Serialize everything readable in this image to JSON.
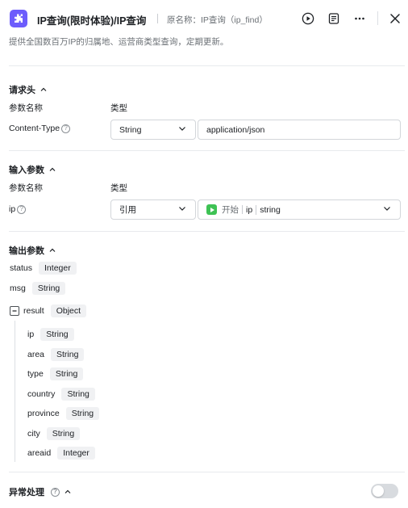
{
  "header": {
    "title": "IP查询(限时体验)/IP查询",
    "original_name": "原名称：IP查询（ip_find）",
    "description": "提供全国数百万IP的归属地、运营商类型查询，定期更新。"
  },
  "request_headers": {
    "title": "请求头",
    "col_name": "参数名称",
    "col_type": "类型",
    "rows": [
      {
        "name": "Content-Type",
        "type": "String",
        "value": "application/json"
      }
    ]
  },
  "input_params": {
    "title": "输入参数",
    "col_name": "参数名称",
    "col_type": "类型",
    "rows": [
      {
        "name": "ip",
        "type": "引用",
        "ref_node": "开始",
        "ref_field": "ip",
        "ref_type": "string"
      }
    ]
  },
  "output_params": {
    "title": "输出参数",
    "items": [
      {
        "name": "status",
        "type": "Integer"
      },
      {
        "name": "msg",
        "type": "String"
      },
      {
        "name": "result",
        "type": "Object"
      }
    ],
    "result_children": [
      {
        "name": "ip",
        "type": "String"
      },
      {
        "name": "area",
        "type": "String"
      },
      {
        "name": "type",
        "type": "String"
      },
      {
        "name": "country",
        "type": "String"
      },
      {
        "name": "province",
        "type": "String"
      },
      {
        "name": "city",
        "type": "String"
      },
      {
        "name": "areaid",
        "type": "Integer"
      }
    ]
  },
  "exception": {
    "title": "异常处理",
    "enabled": false
  },
  "colors": {
    "accent": "#6d5dfc",
    "start_node": "#3ec254",
    "toggle_off": "#d8dbdf"
  },
  "help_glyph": "?"
}
